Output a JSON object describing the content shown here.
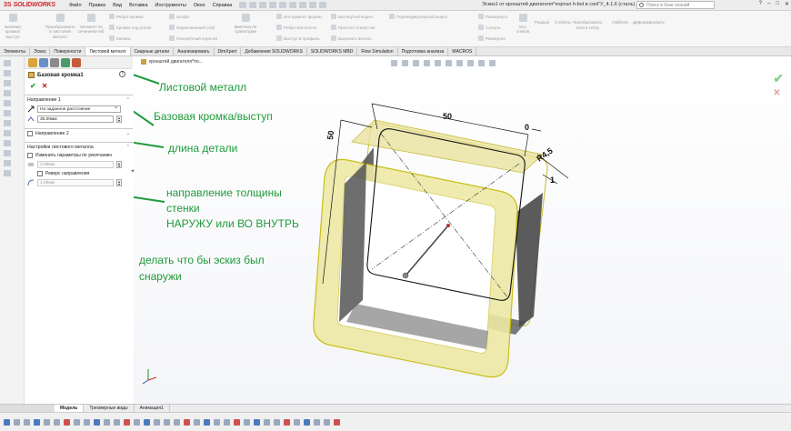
{
  "app": {
    "logo_ds": "3S",
    "logo_name": "SOLIDWORKS",
    "menu": [
      "Файл",
      "Правка",
      "Вид",
      "Вставка",
      "Инструменты",
      "Окно",
      "Справка"
    ],
    "doc_title": "Эскиз1 от кронштей двигателя^портал h-bot в сопГУ_4.1.6 (сталь).sldprt *",
    "search_placeholder": "Поиск в базе знаний",
    "window_controls": [
      "?",
      "–",
      "□",
      "✕"
    ]
  },
  "commands": {
    "big": [
      {
        "label": "Базовая кромка/выступ"
      },
      {
        "label": "Преобразовать в листовой металл"
      },
      {
        "label": "Элемент по сечениям-гиб"
      }
    ],
    "rows": [
      "Ребро-кромка",
      "Кромка под углом",
      "Каемка",
      "Штифт",
      "Нарисованный сгиб",
      "Поперечный перегиб",
      "Вмятина по траектории",
      "Инструмент формы",
      "Ребро жесткости",
      "Выступ в профиль",
      "Вытянутый вырез",
      "Простое отверстие",
      "Вырезать вентил.",
      "Перпендикулярный вырез",
      "Развернуть",
      "Согнуть",
      "Развертка",
      "Без сгибов",
      "Разрыв",
      "Стебель",
      "Преобразовать тела в сетку",
      "Гайбели",
      "Деформировать"
    ]
  },
  "tabs": [
    "Элементы",
    "Эскиз",
    "Поверхности",
    "Листовой металл",
    "Сварные детали",
    "Анализировать",
    "DimXpert",
    "Добавления SOLIDWORKS",
    "SOLIDWORKS MBD",
    "Flow Simulation",
    "Подготовка анализа",
    "MACROS"
  ],
  "active_tab": "Листовой металл",
  "property_manager": {
    "title": "Базовая кромка1",
    "help": "?",
    "ok": "✔",
    "cancel": "✕",
    "direction1": {
      "header": "Направление 1",
      "end_condition": "На заданное расстояние",
      "depth": "35.00мм"
    },
    "direction2": {
      "header": "Направление 2"
    },
    "sheet_metal": {
      "header": "Настройки листового металла",
      "override_label": "Изменить параметры по умолчанию",
      "thickness": "3.00мм",
      "reverse_label": "Реверс направления",
      "bend_radius": "1.00мм"
    }
  },
  "viewport": {
    "breadcrumb": "кронштей двигателя^по...",
    "dimensions": {
      "width": "50",
      "height": "50",
      "offset": "0",
      "radius": "R4,5",
      "thickness": "1"
    },
    "annotations": [
      "Листовой металл",
      "Базовая кромка/выступ",
      "длина детали",
      "направление толщины",
      "стенки",
      "НАРУЖУ или ВО ВНУТРЬ",
      "делать что бы эскиз был",
      "снаружи"
    ]
  },
  "bottom_tabs": [
    "Модель",
    "Трехмерные виды",
    "Анимация1"
  ],
  "active_bottom_tab": "Модель",
  "colors": {
    "annotation": "#1f9a3a",
    "part_fill": "#e8e29a",
    "part_edge": "#b9a800",
    "brand": "#d2232a"
  }
}
